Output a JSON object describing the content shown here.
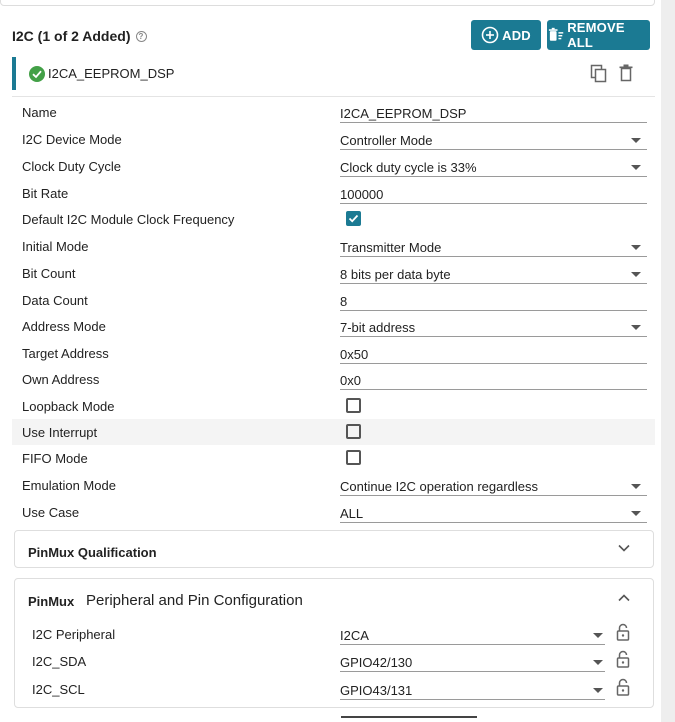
{
  "header": {
    "title": "I2C (1 of 2 Added)",
    "help_icon": "help-circle-icon",
    "add_label": "ADD",
    "remove_all_label": "REMOVE ALL"
  },
  "instance": {
    "name": "I2CA_EEPROM_DSP",
    "status_icon": "check-circle-icon",
    "status_color": "#43a047",
    "accent_color": "#1b7a93"
  },
  "fields": [
    {
      "label": "Name",
      "type": "text",
      "value": "I2CA_EEPROM_DSP"
    },
    {
      "label": "I2C Device Mode",
      "type": "select",
      "value": "Controller Mode"
    },
    {
      "label": "Clock Duty Cycle",
      "type": "select",
      "value": "Clock duty cycle is 33%"
    },
    {
      "label": "Bit Rate",
      "type": "text",
      "value": "100000"
    },
    {
      "label": "Default I2C Module Clock Frequency",
      "type": "checkbox",
      "checked": true
    },
    {
      "label": "Initial Mode",
      "type": "select",
      "value": "Transmitter Mode"
    },
    {
      "label": "Bit Count",
      "type": "select",
      "value": "8 bits per data byte"
    },
    {
      "label": "Data Count",
      "type": "text",
      "value": "8"
    },
    {
      "label": "Address Mode",
      "type": "select",
      "value": "7-bit address"
    },
    {
      "label": "Target Address",
      "type": "text",
      "value": "0x50"
    },
    {
      "label": "Own Address",
      "type": "text",
      "value": "0x0"
    },
    {
      "label": "Loopback Mode",
      "type": "checkbox",
      "checked": false
    },
    {
      "label": "Use Interrupt",
      "type": "checkbox",
      "checked": false
    },
    {
      "label": "FIFO Mode",
      "type": "checkbox",
      "checked": false
    },
    {
      "label": "Emulation Mode",
      "type": "select",
      "value": "Continue I2C operation regardless"
    },
    {
      "label": "Use Case",
      "type": "select",
      "value": "ALL"
    }
  ],
  "pinmux_qualification": {
    "title": "PinMux Qualification",
    "expanded": false
  },
  "pinmux": {
    "title": "PinMux",
    "subtitle": "Peripheral and Pin Configuration",
    "expanded": true,
    "rows": [
      {
        "label": "I2C Peripheral",
        "value": "I2CA"
      },
      {
        "label": "I2C_SDA",
        "value": "GPIO42/130"
      },
      {
        "label": "I2C_SCL",
        "value": "GPIO43/131"
      }
    ]
  }
}
